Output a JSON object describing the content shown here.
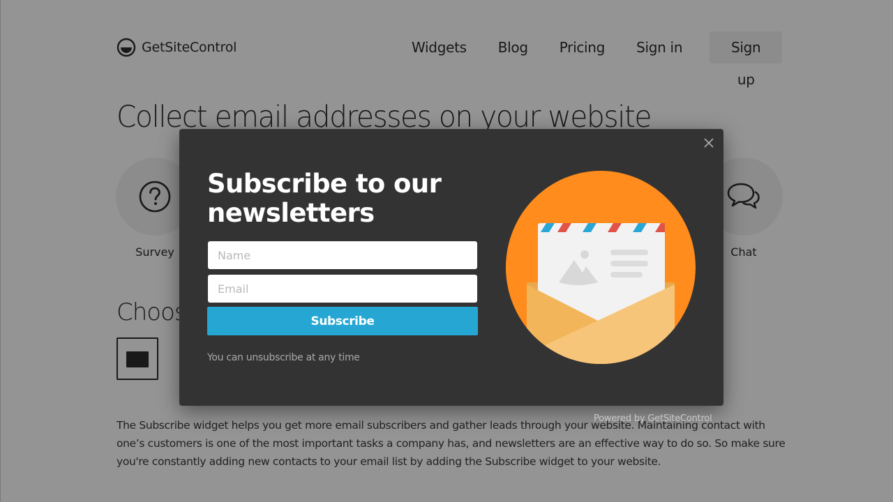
{
  "header": {
    "logo_text": "GetSiteControl",
    "logo_icon": "half-filled-circle-logo",
    "nav": [
      {
        "label": "Widgets"
      },
      {
        "label": "Blog"
      },
      {
        "label": "Pricing"
      },
      {
        "label": "Sign in"
      },
      {
        "label": "Sign up"
      }
    ]
  },
  "hero": {
    "title": "Collect email addresses on your website"
  },
  "widget_types": [
    {
      "label": "Survey",
      "icon": "question-circle-icon"
    },
    {
      "label": "Chat",
      "icon": "chat-bubbles-icon"
    }
  ],
  "choose": {
    "title": "Choose"
  },
  "description": "The Subscribe widget helps you get more email subscribers and gather leads through your website. Maintaining contact with one’s customers is one of the most important tasks a company has, and newsletters are an effective way to do so. So make sure you're constantly adding new contacts to your email list by adding the Subscribe widget to your website.",
  "modal": {
    "title": "Subscribe to our newsletters",
    "name_placeholder": "Name",
    "name_value": "",
    "email_placeholder": "Email",
    "email_value": "",
    "subscribe_label": "Subscribe",
    "note": "You can unsubscribe at any time",
    "close_icon": "close-icon",
    "illustration": "open-envelope-letter-illustration",
    "powered_by": "Powered by GetSiteControl"
  },
  "colors": {
    "accent": "#26a7d3",
    "modal_bg": "#333333",
    "illustration_orange": "#ff8c1c",
    "envelope": "#f5c26d",
    "stripe_red": "#e05348",
    "stripe_blue": "#2aa6d6"
  }
}
